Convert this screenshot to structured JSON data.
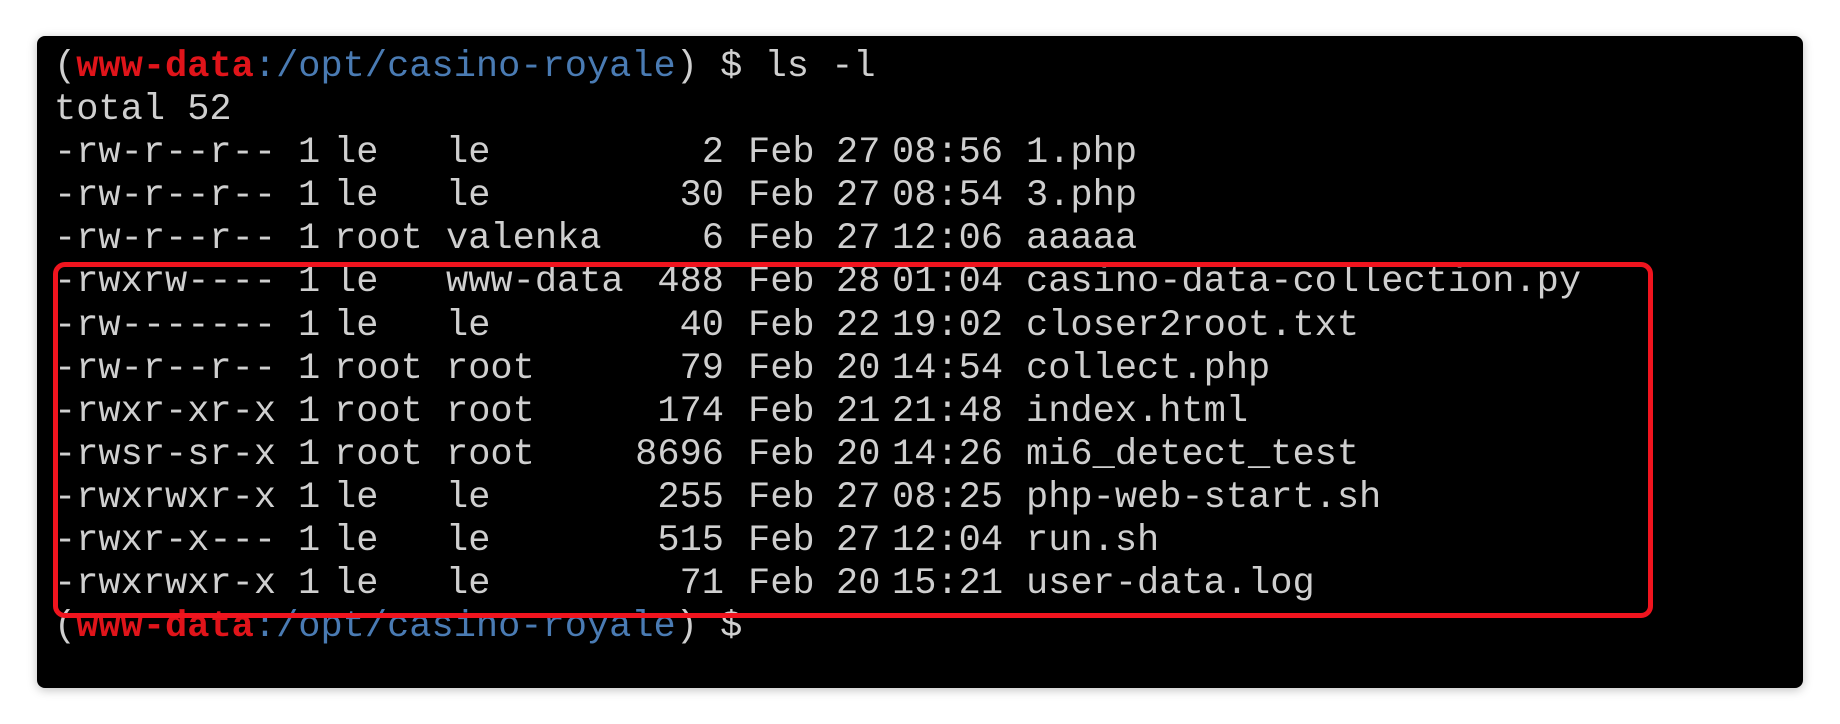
{
  "prompt_top": {
    "open_paren": "(",
    "user": "www-data",
    "path": ":/opt/casino-royale",
    "close_paren": ")",
    "symbol": " $ ",
    "command": "ls -l"
  },
  "total_line": "total 52",
  "entries": [
    {
      "perm": "-rw-r--r--",
      "links": "1",
      "owner": "le",
      "group": "le",
      "size": "2",
      "month": "Feb",
      "day": "27",
      "time": "08:56",
      "name": "1.php"
    },
    {
      "perm": "-rw-r--r--",
      "links": "1",
      "owner": "le",
      "group": "le",
      "size": "30",
      "month": "Feb",
      "day": "27",
      "time": "08:54",
      "name": "3.php"
    },
    {
      "perm": "-rw-r--r--",
      "links": "1",
      "owner": "root",
      "group": "valenka",
      "size": "6",
      "month": "Feb",
      "day": "27",
      "time": "12:06",
      "name": "aaaaa"
    },
    {
      "perm": "-rwxrw----",
      "links": "1",
      "owner": "le",
      "group": "www-data",
      "size": "488",
      "month": "Feb",
      "day": "28",
      "time": "01:04",
      "name": "casino-data-collection.py"
    },
    {
      "perm": "-rw-------",
      "links": "1",
      "owner": "le",
      "group": "le",
      "size": "40",
      "month": "Feb",
      "day": "22",
      "time": "19:02",
      "name": "closer2root.txt"
    },
    {
      "perm": "-rw-r--r--",
      "links": "1",
      "owner": "root",
      "group": "root",
      "size": "79",
      "month": "Feb",
      "day": "20",
      "time": "14:54",
      "name": "collect.php"
    },
    {
      "perm": "-rwxr-xr-x",
      "links": "1",
      "owner": "root",
      "group": "root",
      "size": "174",
      "month": "Feb",
      "day": "21",
      "time": "21:48",
      "name": "index.html"
    },
    {
      "perm": "-rwsr-sr-x",
      "links": "1",
      "owner": "root",
      "group": "root",
      "size": "8696",
      "month": "Feb",
      "day": "20",
      "time": "14:26",
      "name": "mi6_detect_test"
    },
    {
      "perm": "-rwxrwxr-x",
      "links": "1",
      "owner": "le",
      "group": "le",
      "size": "255",
      "month": "Feb",
      "day": "27",
      "time": "08:25",
      "name": "php-web-start.sh"
    },
    {
      "perm": "-rwxr-x---",
      "links": "1",
      "owner": "le",
      "group": "le",
      "size": "515",
      "month": "Feb",
      "day": "27",
      "time": "12:04",
      "name": "run.sh"
    },
    {
      "perm": "-rwxrwxr-x",
      "links": "1",
      "owner": "le",
      "group": "le",
      "size": "71",
      "month": "Feb",
      "day": "20",
      "time": "15:21",
      "name": "user-data.log"
    }
  ],
  "prompt_bottom": {
    "open_paren": "(",
    "user": "www-data",
    "path": ":/opt/casino-royale",
    "close_paren": ")",
    "symbol": " $"
  },
  "colors": {
    "terminal_bg": "#000000",
    "text": "#cfcfcf",
    "user": "#e0141a",
    "path": "#4a7bb3",
    "highlight": "#f0141e"
  }
}
